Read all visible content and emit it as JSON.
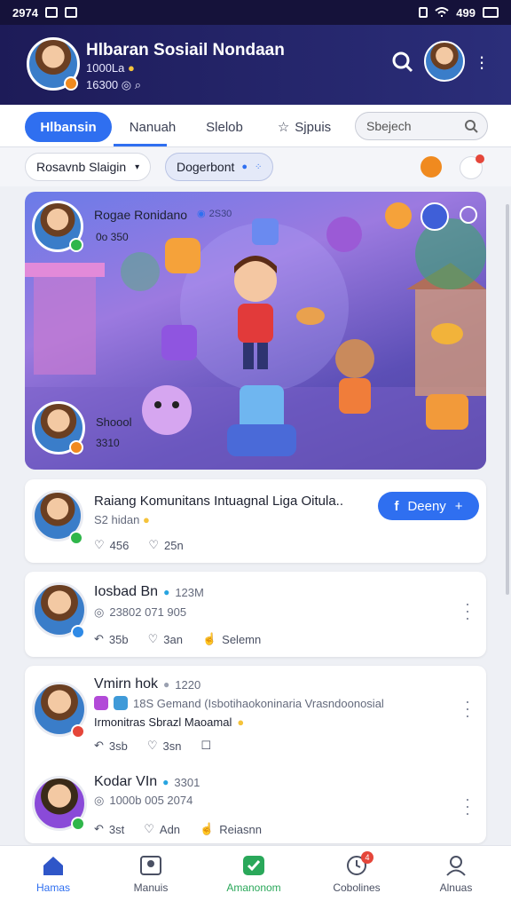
{
  "status": {
    "time": "2974",
    "right": "499"
  },
  "header": {
    "title": "Hlbaran Sosiail Nondaan",
    "sub1": "1000Lа",
    "sub2": "16300"
  },
  "tabs": {
    "items": [
      "Hlbansin",
      "Nanuah",
      "Slelob",
      "Sjpuis"
    ],
    "search_placeholder": "Sbejech"
  },
  "filters": {
    "chip1": "Rosavnb Slaigin",
    "chip2": "Dogerbont"
  },
  "hero": {
    "name": "Rogae Ronidano",
    "tag": "2S30",
    "count": "0o 350",
    "lower_name": "Shoool",
    "lower_count": "3310"
  },
  "cards": [
    {
      "name": "Raiang Komunitans Intuagnal Liga Oitula..",
      "meta": "S2 hidan",
      "likes": "456",
      "hearts": "25n",
      "follow": "Deeny"
    },
    {
      "name": "Iosbad Bn",
      "time": "123M",
      "meta": "23802 071 905",
      "a1": "35b",
      "a2": "3an",
      "a3": "Selemn"
    },
    {
      "name": "Vmirn hok",
      "time": "1220",
      "line1": "18S Gemand (Isbotihaokoninaria Vrasndoonosial",
      "line2": "Irmonitras Sbrazl Maoamal",
      "a1": "3sb",
      "a2": "3sn"
    },
    {
      "name": "Kodar VIn",
      "time": "3301",
      "meta": "1000b 005 2074",
      "a1": "3st",
      "a2": "Adn",
      "a3": "Reiasnn"
    }
  ],
  "nav": [
    "Hamas",
    "Manuis",
    "Amanonom",
    "Cobolines",
    "Alnuas"
  ],
  "nav_badge": "4",
  "colors": {
    "accent": "#2f6ff0",
    "header": "#1d1b58",
    "verified": "#2fb64a"
  }
}
